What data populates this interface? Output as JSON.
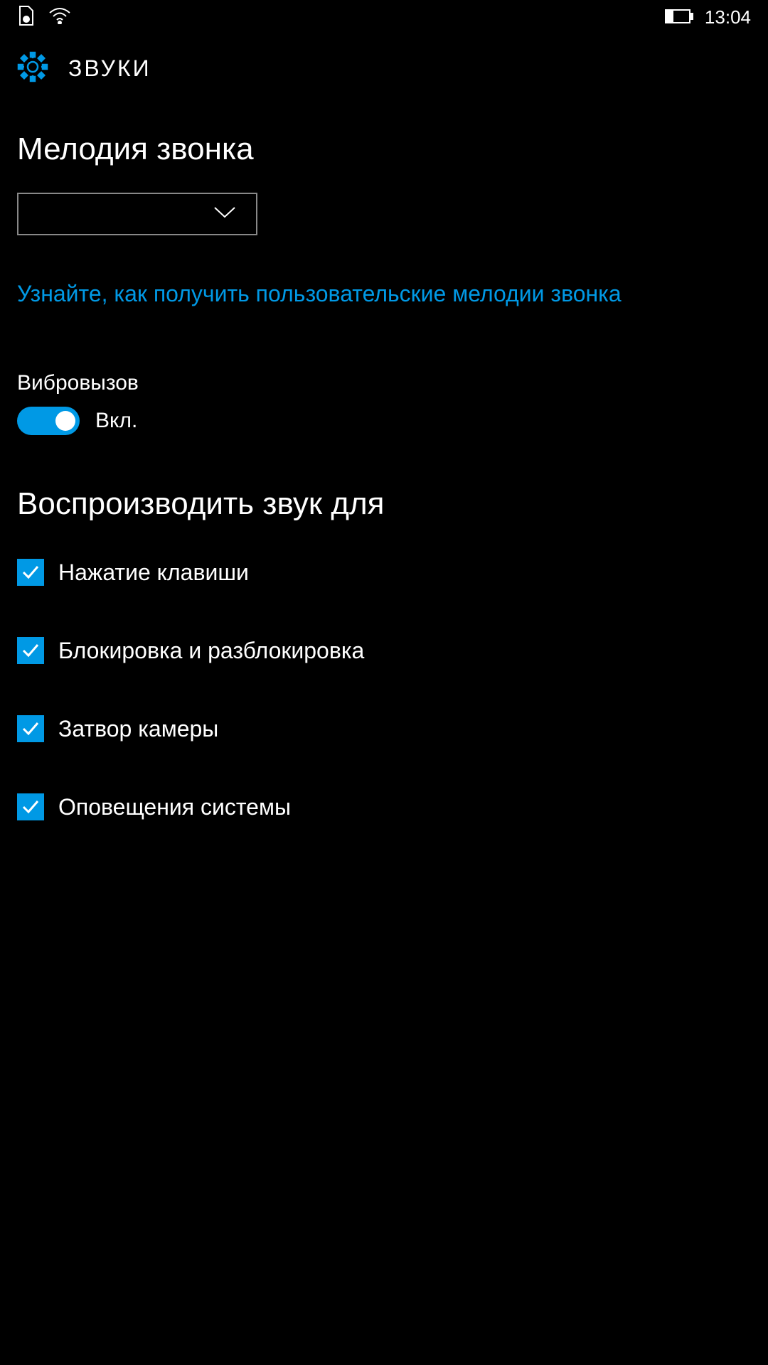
{
  "status_bar": {
    "time": "13:04"
  },
  "header": {
    "title": "ЗВУКИ"
  },
  "ringtone": {
    "section_title": "Мелодия звонка",
    "link_text": "Узнайте, как получить пользовательские мелодии звонка"
  },
  "vibrate": {
    "label": "Вибровызов",
    "state": "Вкл."
  },
  "sounds": {
    "section_title": "Воспроизводить звук для",
    "items": [
      {
        "label": "Нажатие клавиши"
      },
      {
        "label": "Блокировка и разблокировка"
      },
      {
        "label": "Затвор камеры"
      },
      {
        "label": "Оповещения системы"
      }
    ]
  }
}
